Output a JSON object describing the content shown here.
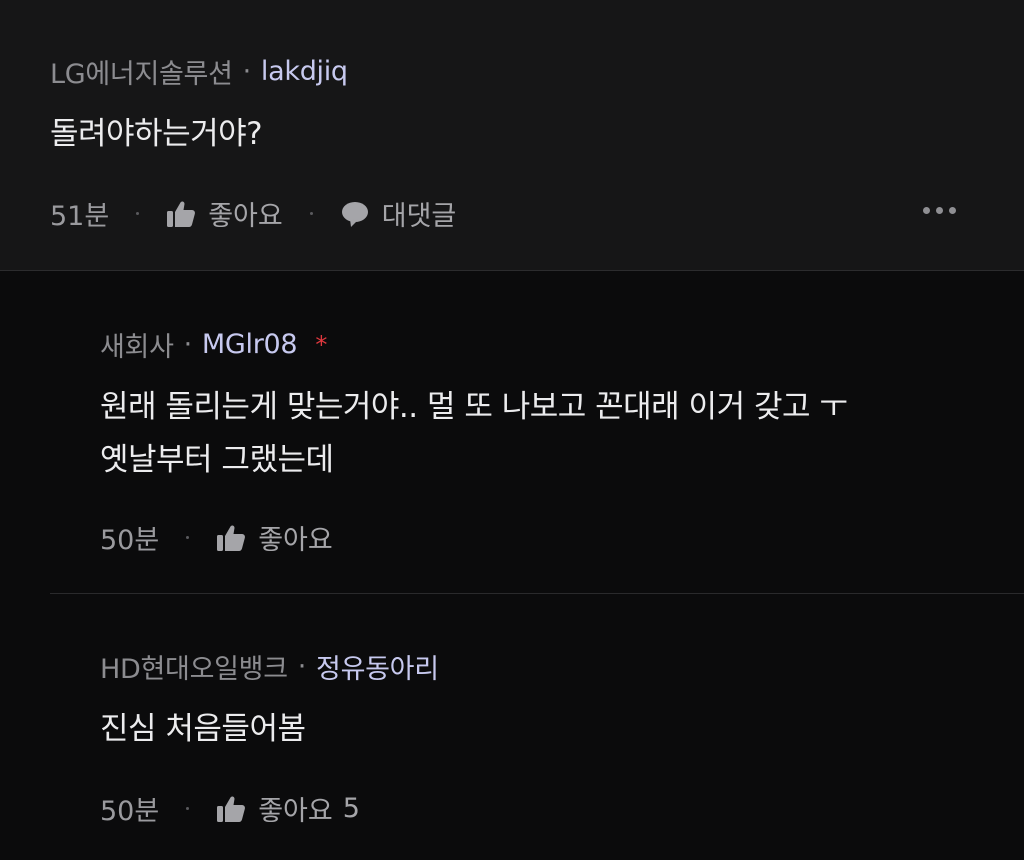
{
  "top_comment": {
    "company": "LG에너지솔루션",
    "separator": "·",
    "username": "lakdjiq",
    "text": "돌려야하는거야?",
    "time": "51분",
    "like_label": "좋아요",
    "reply_label": "대댓글"
  },
  "replies": [
    {
      "company": "새회사",
      "separator": "·",
      "username": "MGlr08",
      "author_marker": "*",
      "text_lines": [
        "원래 돌리는게 맞는거야.. 멀 또 나보고 꼰대래 이거 갖고 ㅜ",
        "옛날부터 그랬는데"
      ],
      "time": "50분",
      "like_label": "좋아요"
    },
    {
      "company": "HD현대오일뱅크",
      "separator": "·",
      "username": "정유동아리",
      "text_lines": [
        "진심 처음들어봄"
      ],
      "time": "50분",
      "like_label": "좋아요",
      "like_count": "5"
    }
  ],
  "icons": {
    "like": "thumbs-up-icon",
    "reply": "speech-bubble-icon",
    "more": "more-options-icon"
  },
  "colors": {
    "background": "#0b0b0c",
    "top_comment_bg": "#161617",
    "username": "#c7c9ef",
    "company": "#8c8c90",
    "author_marker": "#e0383e"
  }
}
